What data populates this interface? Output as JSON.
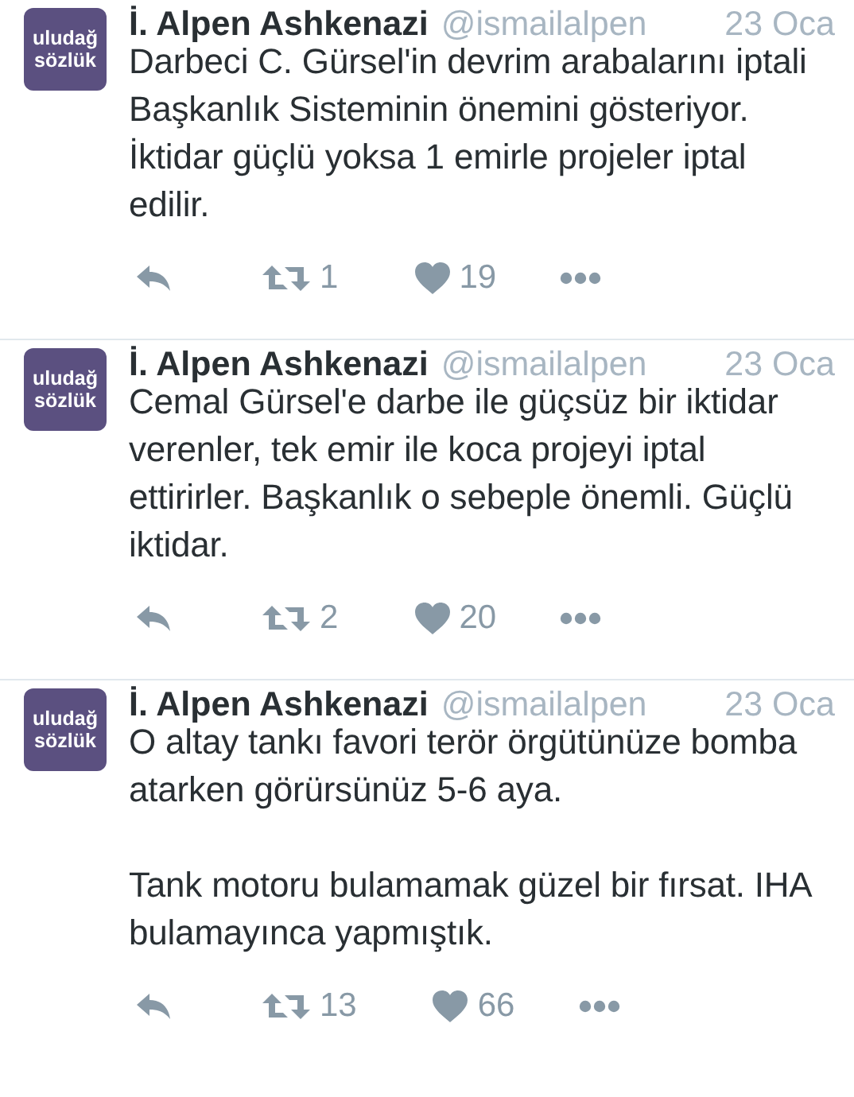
{
  "tweets": [
    {
      "avatar": [
        "uludağ",
        "sözlük"
      ],
      "name": "İ. Alpen Ashkenazi",
      "handle": "@ismailalpen",
      "date": "23 Oca",
      "text": "Darbeci C. Gürsel'in devrim arabalarını iptali Başkanlık Sisteminin önemini gösteriyor. İktidar güçlü yoksa 1 emirle projeler iptal edilir.",
      "retweets": "1",
      "likes": "19"
    },
    {
      "avatar": [
        "uludağ",
        "sözlük"
      ],
      "name": "İ. Alpen Ashkenazi",
      "handle": "@ismailalpen",
      "date": "23 Oca",
      "text": "Cemal Gürsel'e darbe ile güçsüz bir iktidar verenler, tek emir ile koca projeyi iptal ettirirler. Başkanlık o sebeple önemli. Güçlü iktidar.",
      "retweets": "2",
      "likes": "20"
    },
    {
      "avatar": [
        "uludağ",
        "sözlük"
      ],
      "name": "İ. Alpen Ashkenazi",
      "handle": "@ismailalpen",
      "date": "23 Oca",
      "text": "O altay tankı favori terör örgütünüze bomba atarken görürsünüz 5-6 aya.\n\nTank motoru bulamamak güzel bir fırsat. IHA bulamayınca yapmıştık.",
      "retweets": "13",
      "likes": "66"
    }
  ]
}
